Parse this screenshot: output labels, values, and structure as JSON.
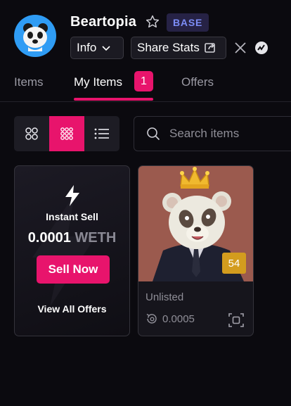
{
  "collection": {
    "name": "Beartopia",
    "chain_badge": "BASE",
    "avatar_icon": "panda-avatar-icon"
  },
  "header": {
    "info_label": "Info",
    "share_label": "Share Stats"
  },
  "tabs": [
    {
      "label": "Items",
      "active": false
    },
    {
      "label": "My Items",
      "active": true,
      "count": "1"
    },
    {
      "label": "Offers",
      "active": false
    }
  ],
  "toolbar": {
    "views": [
      "large-grid-icon",
      "small-grid-icon",
      "list-icon"
    ],
    "active_view": "small-grid-icon",
    "search_placeholder": "Search items"
  },
  "instant_sell": {
    "title": "Instant Sell",
    "price_value": "0.0001",
    "price_currency": "WETH",
    "button_label": "Sell Now",
    "view_all_label": "View All Offers"
  },
  "nft": {
    "rank": "54",
    "status": "Unlisted",
    "last_price": "0.0005"
  },
  "colors": {
    "accent": "#e8146c",
    "badge_bg": "#262245",
    "badge_text": "#7c8df6",
    "rank_bg": "#d39c1e",
    "nft_bg": "#9b5a4e"
  }
}
